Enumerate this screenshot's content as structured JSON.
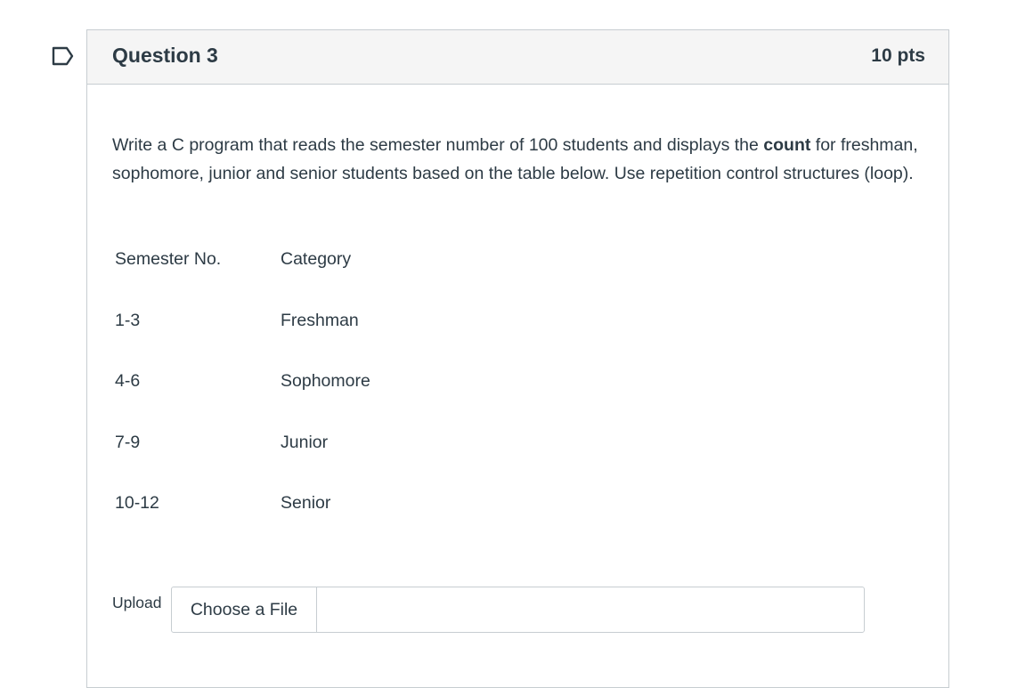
{
  "question": {
    "title": "Question 3",
    "points": "10 pts",
    "text_before": "Write a C program that reads the semester number of 100 students and displays the ",
    "text_bold": "count",
    "text_after": " for freshman, sophomore, junior and senior students based on the table below. Use repetition control structures (loop).",
    "table": {
      "headers": [
        "Semester No.",
        "Category"
      ],
      "rows": [
        [
          "1-3",
          "Freshman"
        ],
        [
          "4-6",
          "Sophomore"
        ],
        [
          "7-9",
          "Junior"
        ],
        [
          "10-12",
          "Senior"
        ]
      ]
    },
    "upload": {
      "label": "Upload",
      "button_label": "Choose a File"
    }
  },
  "colors": {
    "text": "#2d3b45",
    "border": "#c7cdd1",
    "header_bg": "#f5f5f5"
  },
  "icons": {
    "flag": "flag-bookmark-icon"
  }
}
